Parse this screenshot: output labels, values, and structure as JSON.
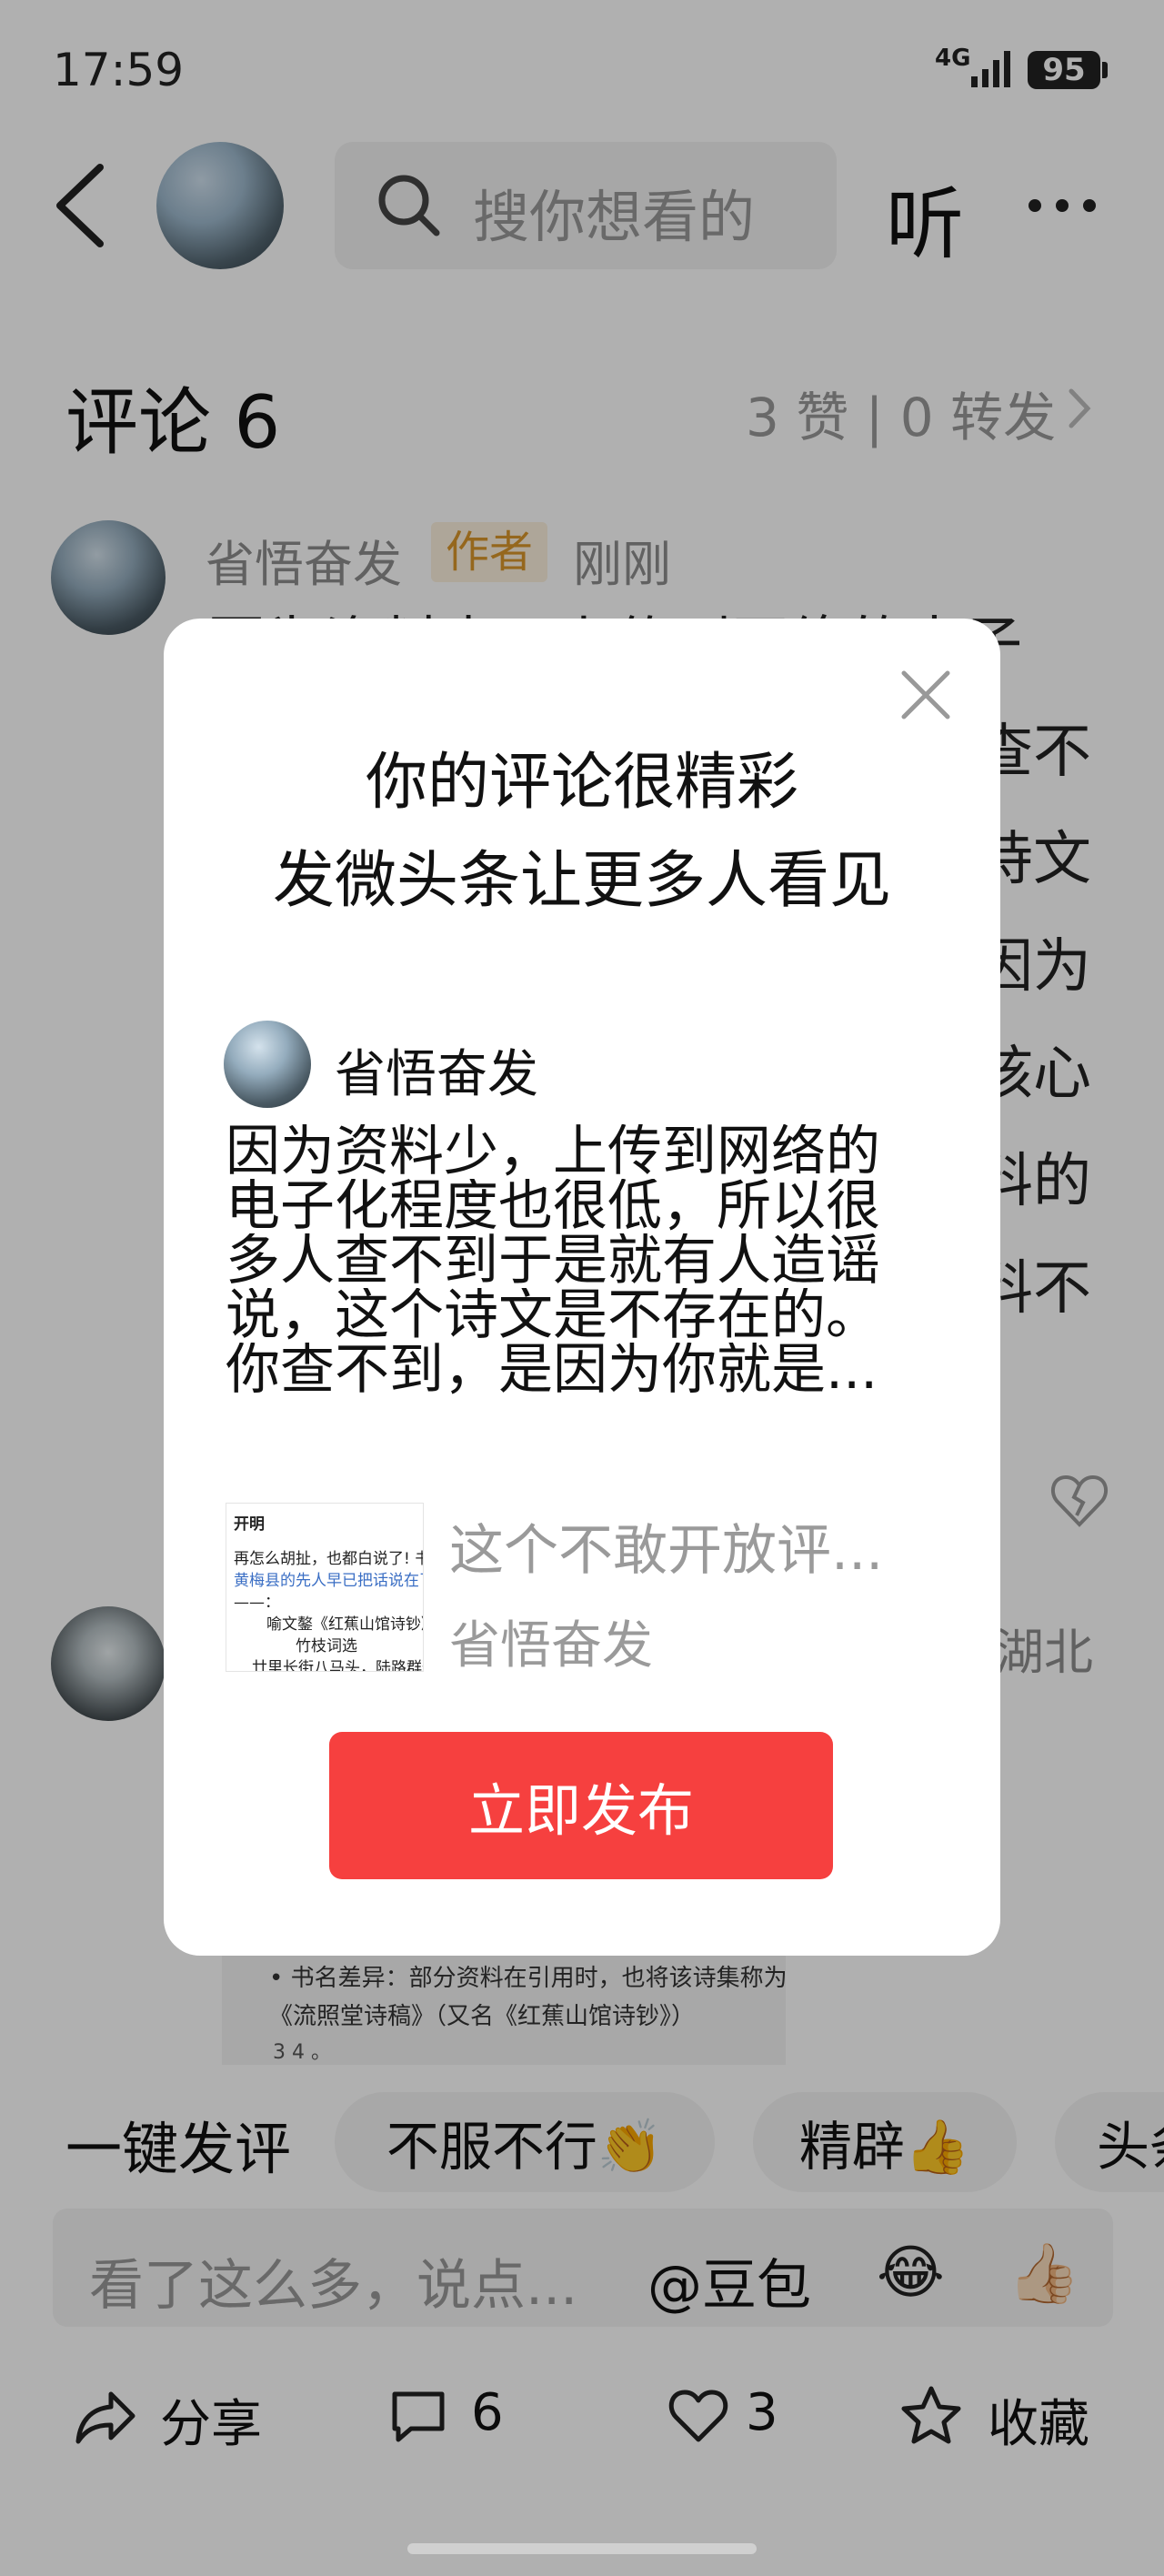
{
  "status_bar": {
    "time": "17:59",
    "network": "4G",
    "battery": "95"
  },
  "header": {
    "search_placeholder": "搜你想看的",
    "listen_label": "听"
  },
  "comments": {
    "title": "评论 6",
    "stats": "3 赞 | 0 转发",
    "first": {
      "author": "省悟奋发",
      "badge": "作者",
      "time": "刚刚",
      "visible_line_ends": [
        "电子",
        "查不",
        "诗文",
        "因为",
        "核心",
        "料的",
        "料不"
      ],
      "first_line": "因为资料少，上传到网络的电子"
    },
    "second": {
      "region": "湖北"
    },
    "reference": {
      "line1": "• 书名差异：部分资料在引用时，也将该诗集称为",
      "line2": "《流照堂诗稿》（又名《红蕉山馆诗钞》）",
      "nums": "3 4 。"
    }
  },
  "quick_reply": {
    "label": "一键发评",
    "chips": [
      "不服不行👏",
      "精辟👍",
      "头条"
    ]
  },
  "input_bar": {
    "placeholder": "看了这么多，说点...",
    "mention": "@豆包",
    "emoji1": "😂",
    "emoji2": "👍🏻"
  },
  "actions": {
    "share": "分享",
    "comment_count": "6",
    "like_count": "3",
    "collect": "收藏"
  },
  "dialog": {
    "title_line1": "你的评论很精彩",
    "title_line2": "发微头条让更多人看见",
    "author": "省悟奋发",
    "body_lines": [
      "因为资料少，上传到网络的",
      "电子化程度也很低，所以很",
      "多人查不到于是就有人造谣",
      "说，这个诗文是不存在的。",
      "你查不到，是因为你就是..."
    ],
    "thumb_lines": [
      "开明",
      "再怎么胡扯，也都白说了! 书",
      "黄梅县的先人早已把话说在了",
      "——：",
      "喻文鏊《红蕉山馆诗钞》",
      "竹枝词选",
      "廿里长街八马头，陆路群聚"
    ],
    "ref_title": "这个不敢开放评...",
    "ref_author": "省悟奋发",
    "publish_label": "立即发布"
  }
}
